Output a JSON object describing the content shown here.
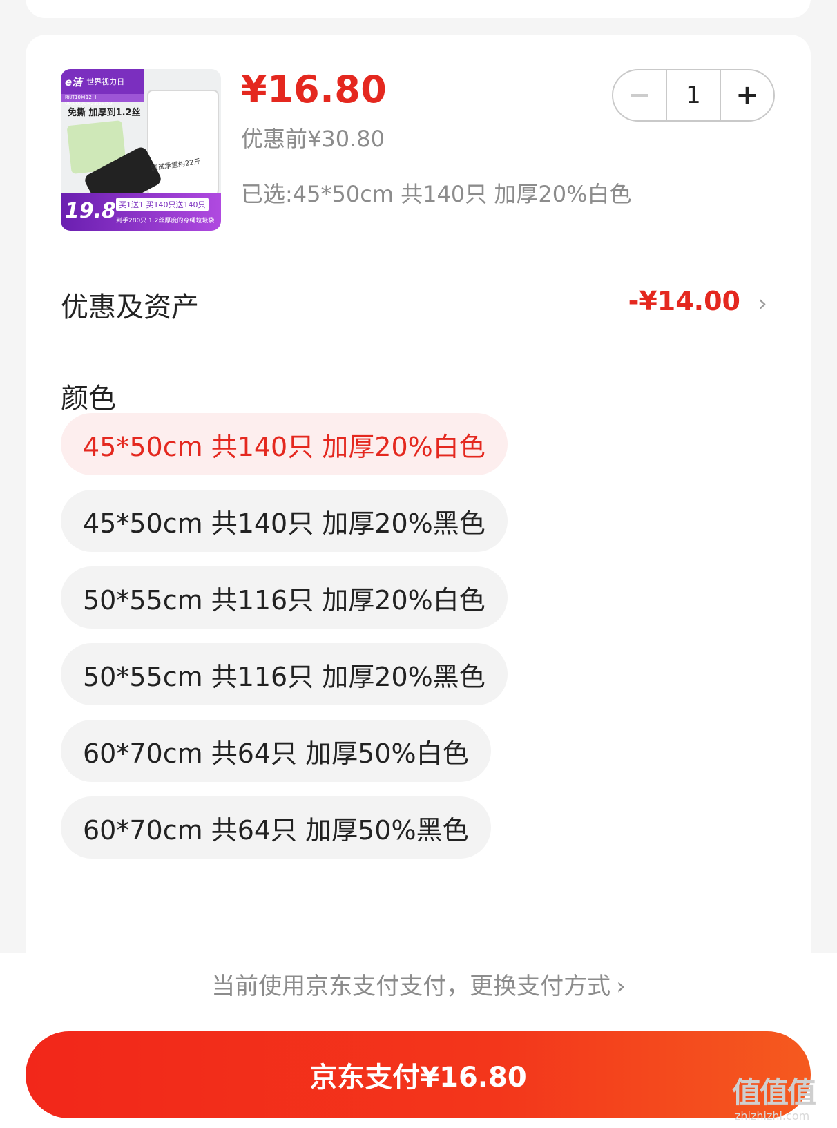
{
  "product": {
    "price": "¥16.80",
    "price_before": "优惠前¥30.80",
    "selected_summary": "已选:45*50cm 共140只 加厚20%白色",
    "thumbnail": {
      "logo": "e洁",
      "banner": "世界视力日",
      "time_note": "限时10月12日00:00:00~23:59:59",
      "headline": "免撕 加厚到1.2丝",
      "bag_text": "测试承重约22斤",
      "promo_price": "19.8",
      "promo_tag": "买1送1",
      "promo_offer": "买140只送140只",
      "promo_note": "到手280只 1.2丝厚度的穿绳垃圾袋"
    }
  },
  "quantity": {
    "minus_icon": "minus-icon",
    "plus_icon": "plus-icon",
    "minus": "−",
    "plus": "+",
    "value": "1"
  },
  "discount": {
    "label": "优惠及资产",
    "value": "-¥14.00",
    "chevron": "›"
  },
  "color_section": {
    "label": "颜色",
    "options": [
      {
        "label": "45*50cm 共140只 加厚20%白色",
        "selected": true
      },
      {
        "label": "45*50cm 共140只 加厚20%黑色",
        "selected": false
      },
      {
        "label": "50*55cm 共116只 加厚20%白色",
        "selected": false
      },
      {
        "label": "50*55cm 共116只 加厚20%黑色",
        "selected": false
      },
      {
        "label": "60*70cm 共64只 加厚50%白色",
        "selected": false
      },
      {
        "label": "60*70cm 共64只 加厚50%黑色",
        "selected": false
      }
    ]
  },
  "payment": {
    "hint": "当前使用京东支付支付，更换支付方式",
    "hint_chevron": "›",
    "button_label": "京东支付¥16.80"
  },
  "watermark": {
    "text": "值值值",
    "site": "zhizhizhi.com"
  },
  "colors": {
    "accent_red": "#e4281f",
    "selected_bg": "#fdeeee",
    "option_bg": "#f3f3f3",
    "muted_text": "#8c8c8c"
  }
}
